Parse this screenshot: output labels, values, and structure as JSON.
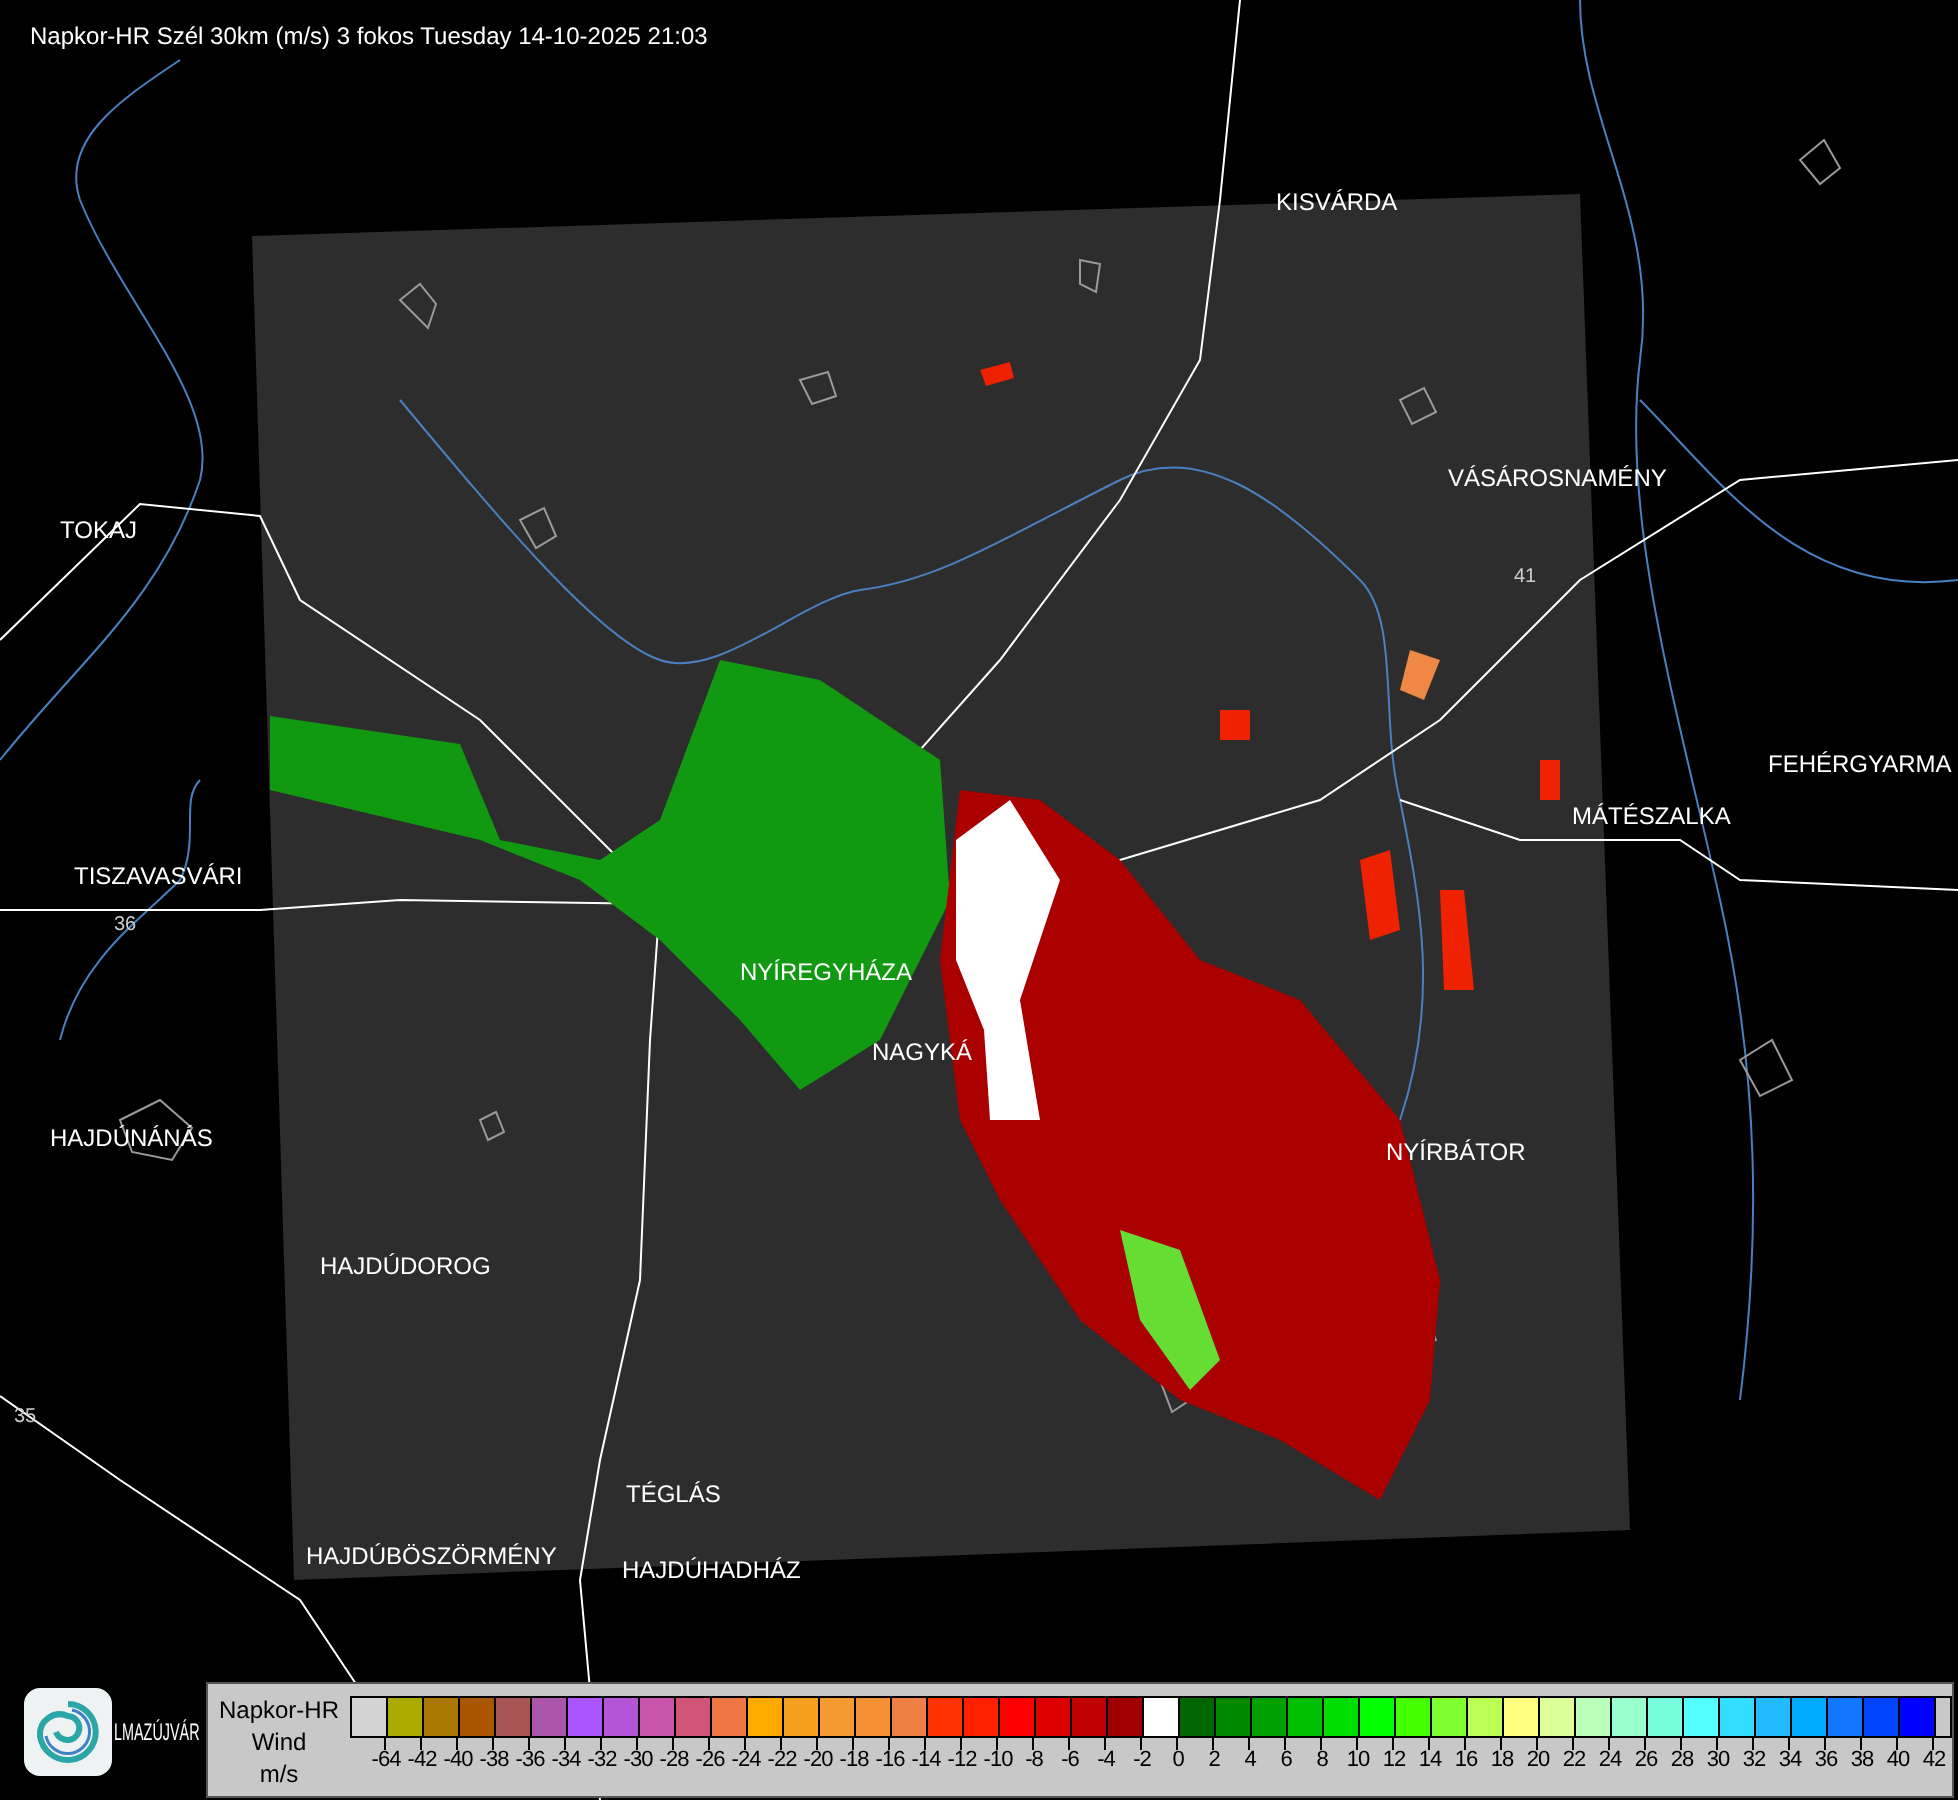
{
  "header": {
    "title": "Napkor-HR Szél 30km (m/s) 3 fokos Tuesday 14-10-2025 21:03"
  },
  "map": {
    "places": [
      {
        "name": "KISVÁRDA",
        "kind": "town"
      },
      {
        "name": "VÁSÁROSNAMÉNY",
        "kind": "town"
      },
      {
        "name": "TOKAJ",
        "kind": "town"
      },
      {
        "name": "41",
        "kind": "road"
      },
      {
        "name": "FEHÉRGYARMA",
        "kind": "town"
      },
      {
        "name": "MÁTÉSZALKA",
        "kind": "town"
      },
      {
        "name": "TISZAVASVÁRI",
        "kind": "town"
      },
      {
        "name": "36",
        "kind": "road"
      },
      {
        "name": "NYÍREGYHÁZA",
        "kind": "town"
      },
      {
        "name": "NAGYKÁ",
        "kind": "town"
      },
      {
        "name": "HAJDÚNÁNÁS",
        "kind": "town"
      },
      {
        "name": "NYÍRBÁTOR",
        "kind": "town"
      },
      {
        "name": "HAJDÚDOROG",
        "kind": "town"
      },
      {
        "name": "35",
        "kind": "road"
      },
      {
        "name": "TÉGLÁS",
        "kind": "town"
      },
      {
        "name": "HAJDÚBÖSZÖRMÉNY",
        "kind": "town"
      },
      {
        "name": "HAJDÚHADHÁZ",
        "kind": "town"
      },
      {
        "name": "LMAZÚJVÁR",
        "kind": "town"
      }
    ]
  },
  "legend": {
    "title": [
      "Napkor-HR",
      "Wind",
      "m/s"
    ],
    "swatches": [
      {
        "color": "#d3d3d3",
        "label": "-64"
      },
      {
        "color": "#aaaa00",
        "label": "-42"
      },
      {
        "color": "#aa7700",
        "label": "-40"
      },
      {
        "color": "#aa5500",
        "label": "-38"
      },
      {
        "color": "#aa5555",
        "label": "-36"
      },
      {
        "color": "#aa55aa",
        "label": "-34"
      },
      {
        "color": "#aa55ff",
        "label": "-32"
      },
      {
        "color": "#b455d8",
        "label": "-30"
      },
      {
        "color": "#c855aa",
        "label": "-28"
      },
      {
        "color": "#d05577",
        "label": "-26"
      },
      {
        "color": "#ee7744",
        "label": "-24"
      },
      {
        "color": "#ffaa00",
        "label": "-22"
      },
      {
        "color": "#f5a020",
        "label": "-20"
      },
      {
        "color": "#f59a30",
        "label": "-18"
      },
      {
        "color": "#f59035",
        "label": "-16"
      },
      {
        "color": "#ee8044",
        "label": "-14"
      },
      {
        "color": "#ff3300",
        "label": "-12"
      },
      {
        "color": "#ff2000",
        "label": "-10"
      },
      {
        "color": "#ff0000",
        "label": "-8"
      },
      {
        "color": "#dd0000",
        "label": "-6"
      },
      {
        "color": "#c00000",
        "label": "-4"
      },
      {
        "color": "#a00000",
        "label": "-2"
      },
      {
        "color": "#ffffff",
        "label": "0"
      },
      {
        "color": "#006600",
        "label": "2"
      },
      {
        "color": "#008800",
        "label": "4"
      },
      {
        "color": "#00a000",
        "label": "6"
      },
      {
        "color": "#00c000",
        "label": "8"
      },
      {
        "color": "#00dd00",
        "label": "10"
      },
      {
        "color": "#00ff00",
        "label": "12"
      },
      {
        "color": "#44ff00",
        "label": "14"
      },
      {
        "color": "#80ff30",
        "label": "16"
      },
      {
        "color": "#bbff55",
        "label": "18"
      },
      {
        "color": "#ffff80",
        "label": "20"
      },
      {
        "color": "#ddff99",
        "label": "22"
      },
      {
        "color": "#bbffbb",
        "label": "24"
      },
      {
        "color": "#99ffcc",
        "label": "26"
      },
      {
        "color": "#77ffdd",
        "label": "28"
      },
      {
        "color": "#55ffff",
        "label": "30"
      },
      {
        "color": "#33ddff",
        "label": "32"
      },
      {
        "color": "#22bbff",
        "label": "34"
      },
      {
        "color": "#00aaff",
        "label": "36"
      },
      {
        "color": "#1177ff",
        "label": "38"
      },
      {
        "color": "#0044ff",
        "label": "40"
      },
      {
        "color": "#0000ff",
        "label": "42"
      }
    ]
  }
}
